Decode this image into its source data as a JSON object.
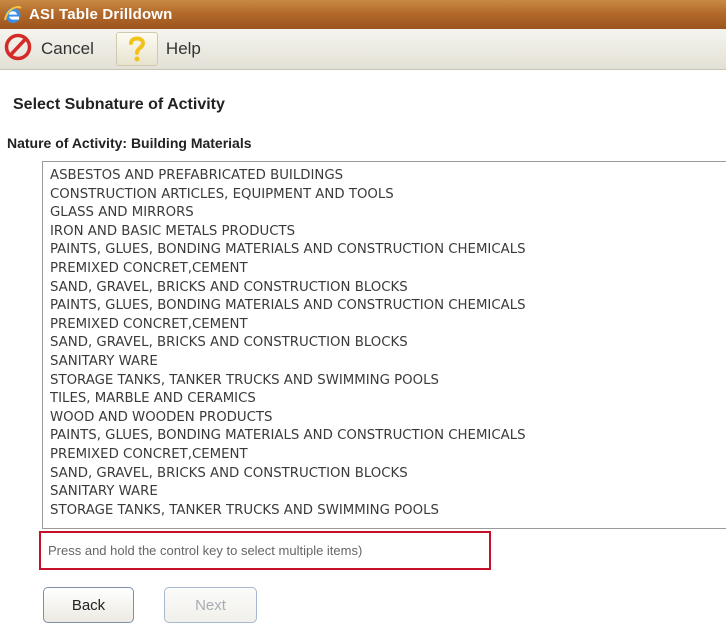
{
  "window": {
    "title": "ASI Table Drilldown"
  },
  "toolbar": {
    "cancel_label": "Cancel",
    "help_label": "Help"
  },
  "main": {
    "heading": "Select Subnature of Activity",
    "nature_line": "Nature of Activity: Building Materials",
    "items": [
      "ASBESTOS AND PREFABRICATED BUILDINGS",
      "CONSTRUCTION ARTICLES, EQUIPMENT AND TOOLS",
      "GLASS AND MIRRORS",
      "IRON AND BASIC METALS PRODUCTS",
      "PAINTS, GLUES, BONDING MATERIALS AND CONSTRUCTION CHEMICALS",
      "PREMIXED CONCRET,CEMENT",
      "SAND, GRAVEL, BRICKS AND CONSTRUCTION BLOCKS",
      "PAINTS, GLUES, BONDING MATERIALS AND CONSTRUCTION CHEMICALS",
      "PREMIXED CONCRET,CEMENT",
      "SAND, GRAVEL, BRICKS AND CONSTRUCTION BLOCKS",
      "SANITARY WARE",
      "STORAGE TANKS, TANKER TRUCKS AND SWIMMING POOLS",
      "TILES, MARBLE AND CERAMICS",
      "WOOD AND WOODEN PRODUCTS",
      "PAINTS, GLUES, BONDING MATERIALS AND CONSTRUCTION CHEMICALS",
      "PREMIXED CONCRET,CEMENT",
      "SAND, GRAVEL, BRICKS AND CONSTRUCTION BLOCKS",
      "SANITARY WARE",
      "STORAGE TANKS, TANKER TRUCKS AND SWIMMING POOLS"
    ],
    "hint": "Press and hold the control key to select multiple items)",
    "back_label": "Back",
    "next_label": "Next"
  },
  "colors": {
    "titlebar": "#b36a2a",
    "hint_border": "#c5102b",
    "cancel_icon": "#d42a2a",
    "help_icon": "#f2c21b"
  }
}
